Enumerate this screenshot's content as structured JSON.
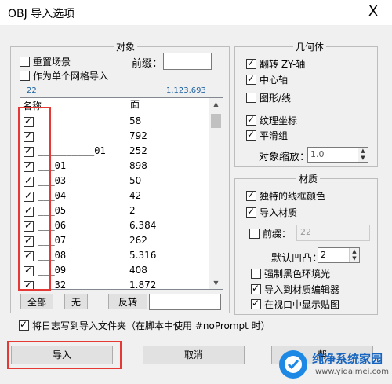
{
  "window": {
    "title": "OBJ 导入选项",
    "close": "X"
  },
  "object_group": {
    "title": "对象",
    "reset_scene": {
      "label": "重置场景",
      "checked": false
    },
    "single_mesh": {
      "label": "作为单个网格导入",
      "checked": false
    },
    "prefix_label": "前缀：",
    "prefix_value": "",
    "count": "22",
    "total": "1.123.693",
    "headers": {
      "name": "名称",
      "faces": "面"
    },
    "rows": [
      {
        "name": "___",
        "faces": "58"
      },
      {
        "name": "__________",
        "faces": "792"
      },
      {
        "name": "__________01",
        "faces": "252"
      },
      {
        "name": "___01",
        "faces": "898"
      },
      {
        "name": "___03",
        "faces": "50"
      },
      {
        "name": "___04",
        "faces": "42"
      },
      {
        "name": "___05",
        "faces": "2"
      },
      {
        "name": "___06",
        "faces": "6.384"
      },
      {
        "name": "___07",
        "faces": "262"
      },
      {
        "name": "___08",
        "faces": "5.316"
      },
      {
        "name": "___09",
        "faces": "408"
      },
      {
        "name": "___32",
        "faces": "1.872"
      }
    ],
    "btn_all": "全部",
    "btn_none": "无",
    "btn_invert": "反转",
    "filter_value": ""
  },
  "geometry_group": {
    "title": "几何体",
    "flip_zy": {
      "label": "翻转 ZY-轴",
      "checked": true
    },
    "center_pivot": {
      "label": "中心轴",
      "checked": true
    },
    "shapes": {
      "label": "图形/线",
      "checked": false
    },
    "texture_coords": {
      "label": "纹理坐标",
      "checked": true
    },
    "smooth_groups": {
      "label": "平滑组",
      "checked": true
    },
    "scale_label": "对象缩放：",
    "scale_value": "1.0"
  },
  "material_group": {
    "title": "材质",
    "unique_wire": {
      "label": "独特的线框颜色",
      "checked": true
    },
    "import_mat": {
      "label": "导入材质",
      "checked": true
    },
    "prefix": {
      "label": "前缀：",
      "checked": false
    },
    "prefix_value": "22",
    "bump_label": "默认凹凸：",
    "bump_value": "2",
    "force_black": {
      "label": "强制黑色环境光",
      "checked": false
    },
    "to_editor": {
      "label": "导入到材质编辑器",
      "checked": true
    },
    "show_maps": {
      "label": "在视口中显示贴图",
      "checked": true
    }
  },
  "log": {
    "label": "将日志写到导入文件夹（在脚本中使用 #noPrompt 时）",
    "checked": true
  },
  "buttons": {
    "import": "导入",
    "cancel": "取消",
    "third": "帮"
  },
  "watermark": {
    "title": "纯净系统家园",
    "url": "www.yidaimei.com"
  },
  "colors": {
    "highlight": "#e53935"
  }
}
